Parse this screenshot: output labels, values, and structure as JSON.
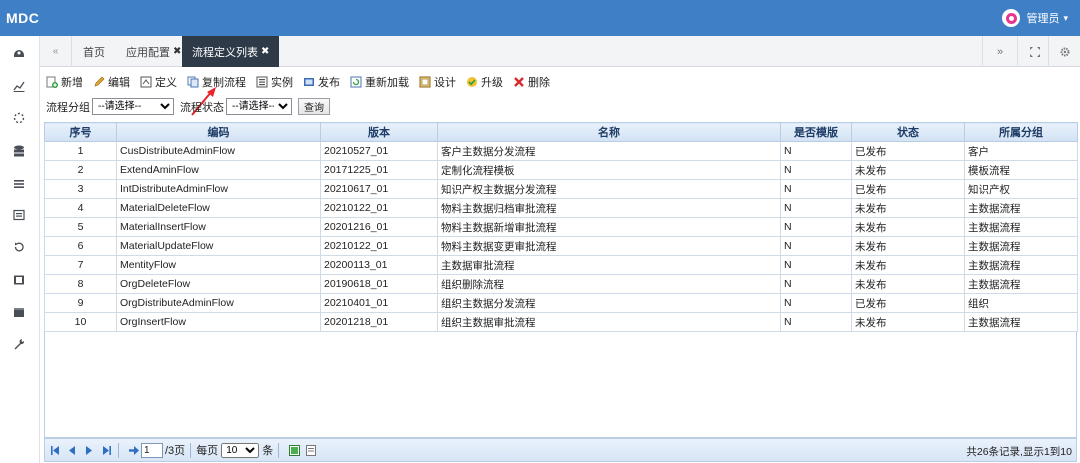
{
  "header": {
    "brand": "MDC",
    "user": "管理员",
    "user_caret": "▾"
  },
  "sidebar": {
    "icons": [
      "dashboard-icon",
      "chart-icon",
      "loader-icon",
      "database-icon",
      "menu-icon",
      "list-icon",
      "history-icon",
      "film-icon",
      "archive-icon",
      "wrench-icon"
    ]
  },
  "tabs": {
    "nav_prev": "«",
    "items": [
      {
        "label": "首页",
        "closable": false
      },
      {
        "label": "应用配置",
        "closable": true
      },
      {
        "label": "流程定义列表",
        "closable": true,
        "active": true
      }
    ],
    "close_glyph": "✖",
    "nav_next": "»"
  },
  "toolbar": {
    "buttons": [
      {
        "label": "新增",
        "icon": "add-icon"
      },
      {
        "label": "编辑",
        "icon": "edit-icon"
      },
      {
        "label": "定义",
        "icon": "define-icon"
      },
      {
        "label": "复制流程",
        "icon": "copy-icon"
      },
      {
        "label": "实例",
        "icon": "instance-icon"
      },
      {
        "label": "发布",
        "icon": "publish-icon"
      },
      {
        "label": "重新加载",
        "icon": "reload-icon"
      },
      {
        "label": "设计",
        "icon": "design-icon"
      },
      {
        "label": "升级",
        "icon": "upgrade-icon"
      },
      {
        "label": "删除",
        "icon": "delete-icon"
      }
    ]
  },
  "filter": {
    "group_label": "流程分组",
    "group_value": "--请选择--",
    "status_label": "流程状态",
    "status_value": "--请选择--",
    "query_label": "查询"
  },
  "table": {
    "columns": [
      "序号",
      "编码",
      "版本",
      "名称",
      "是否模版",
      "状态",
      "所属分组"
    ],
    "rows": [
      [
        "1",
        "CusDistributeAdminFlow",
        "20210527_01",
        "客户主数据分发流程",
        "N",
        "已发布",
        "客户"
      ],
      [
        "2",
        "ExtendAminFlow",
        "20171225_01",
        "定制化流程模板",
        "N",
        "未发布",
        "模板流程"
      ],
      [
        "3",
        "IntDistributeAdminFlow",
        "20210617_01",
        "知识产权主数据分发流程",
        "N",
        "已发布",
        "知识产权"
      ],
      [
        "4",
        "MaterialDeleteFlow",
        "20210122_01",
        "物料主数据归档审批流程",
        "N",
        "未发布",
        "主数据流程"
      ],
      [
        "5",
        "MaterialInsertFlow",
        "20201216_01",
        "物料主数据新增审批流程",
        "N",
        "未发布",
        "主数据流程"
      ],
      [
        "6",
        "MaterialUpdateFlow",
        "20210122_01",
        "物料主数据变更审批流程",
        "N",
        "未发布",
        "主数据流程"
      ],
      [
        "7",
        "MentityFlow",
        "20200113_01",
        "主数据审批流程",
        "N",
        "未发布",
        "主数据流程"
      ],
      [
        "8",
        "OrgDeleteFlow",
        "20190618_01",
        "组织删除流程",
        "N",
        "未发布",
        "主数据流程"
      ],
      [
        "9",
        "OrgDistributeAdminFlow",
        "20210401_01",
        "组织主数据分发流程",
        "N",
        "已发布",
        "组织"
      ],
      [
        "10",
        "OrgInsertFlow",
        "20201218_01",
        "组织主数据审批流程",
        "N",
        "未发布",
        "主数据流程"
      ]
    ]
  },
  "pager": {
    "page": "1",
    "total_pages": "/3页",
    "per_page_label": "每页",
    "per_page_value": "10",
    "per_page_unit": "条",
    "summary": "共26条记录,显示1到10"
  },
  "colors": {
    "header": "#3f7fc6",
    "active_tab": "#2f3a48",
    "grid_header": "#d2e2f4",
    "annotation_arrow": "#e8232a"
  }
}
